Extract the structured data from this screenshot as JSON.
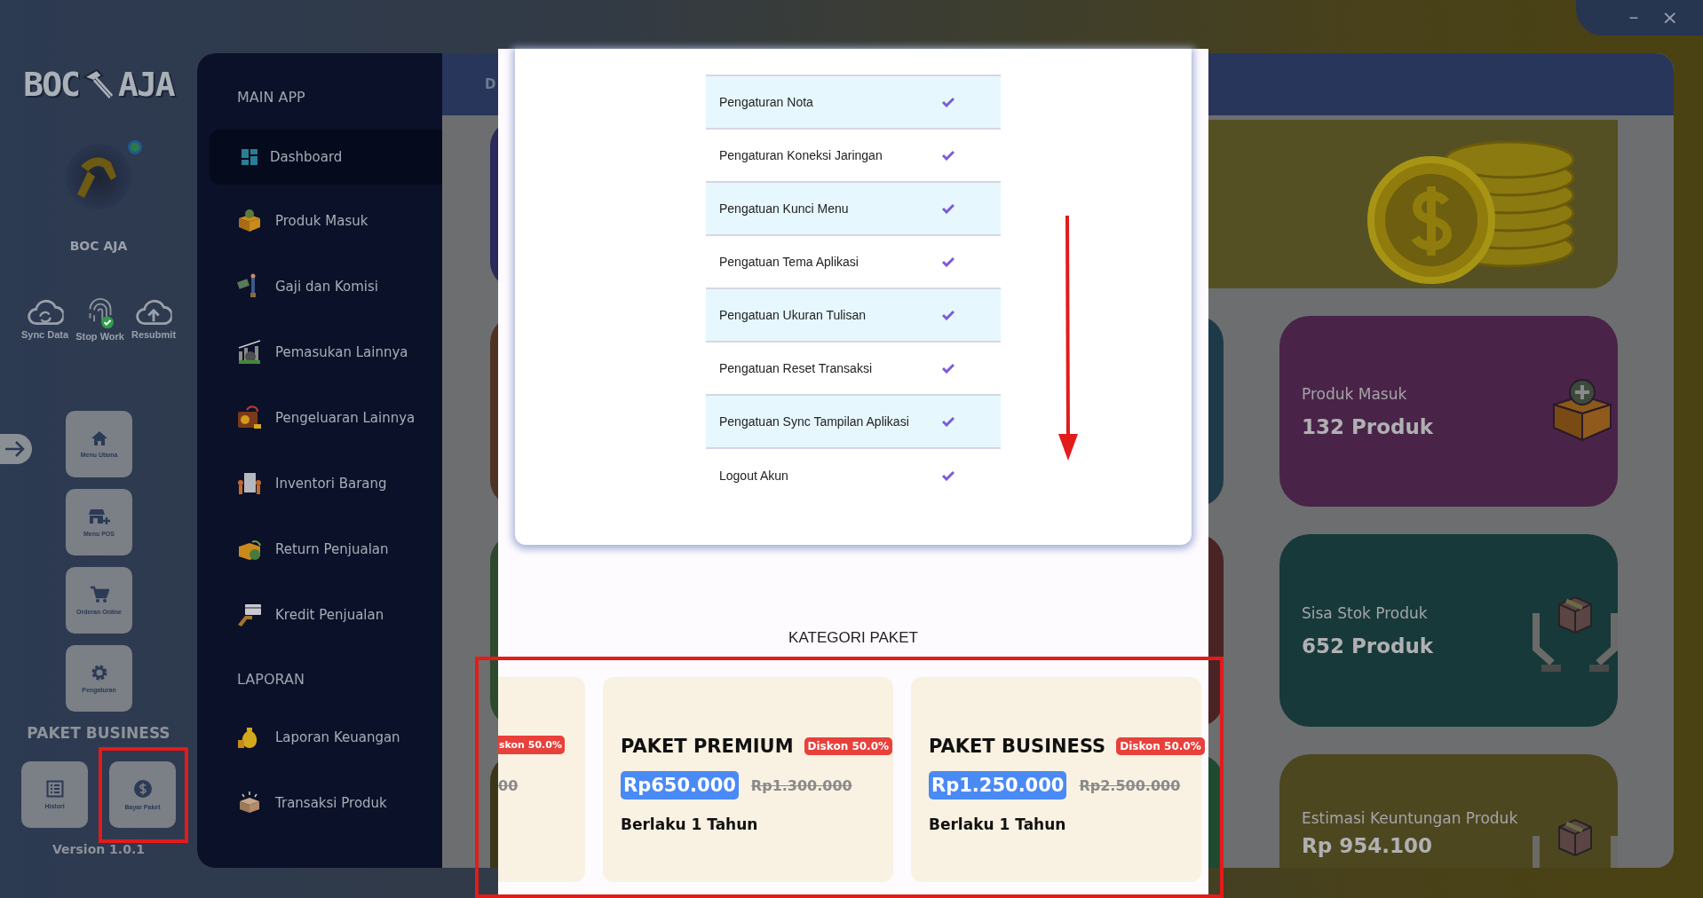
{
  "window_controls": [
    {
      "kind": "minimize",
      "label": "–"
    },
    {
      "kind": "close",
      "label": "×"
    }
  ],
  "rail": {
    "logo": {
      "left": "BOC",
      "right": "AJA"
    },
    "profile": {
      "name": "BOC AJA"
    },
    "actions": [
      {
        "kind": "sync",
        "label": "Sync Data"
      },
      {
        "kind": "fingerprint",
        "label": "Stop Work"
      },
      {
        "kind": "upload",
        "label": "Resubmit"
      }
    ],
    "menu_buttons": [
      {
        "kind": "home",
        "label": "Menu Utama"
      },
      {
        "kind": "store",
        "label": "Menu POS"
      },
      {
        "kind": "cart",
        "label": "Orderan Online"
      },
      {
        "kind": "gear",
        "label": "Pengaturan"
      }
    ],
    "package_title": "PAKET BUSINESS",
    "package_buttons": [
      {
        "kind": "list",
        "label": "Histori"
      },
      {
        "kind": "dollar",
        "label": "Bayar Paket"
      }
    ],
    "version": "Version 1.0.1"
  },
  "nav": {
    "sections": [
      {
        "title": "MAIN APP",
        "items": [
          {
            "kind": "dashboard",
            "label": "Dashboard",
            "selected": true
          },
          {
            "kind": "box",
            "label": "Produk Masuk",
            "selected": false
          },
          {
            "kind": "salary",
            "label": "Gaji dan Komisi",
            "selected": false
          },
          {
            "kind": "income",
            "label": "Pemasukan Lainnya",
            "selected": false
          },
          {
            "kind": "wallet",
            "label": "Pengeluaran Lainnya",
            "selected": false
          },
          {
            "kind": "inventory",
            "label": "Inventori Barang",
            "selected": false
          },
          {
            "kind": "return",
            "label": "Return Penjualan",
            "selected": false
          },
          {
            "kind": "card",
            "label": "Kredit Penjualan",
            "selected": false
          }
        ]
      },
      {
        "title": "LAPORAN",
        "items": [
          {
            "kind": "moneybag",
            "label": "Laporan Keuangan",
            "selected": false
          },
          {
            "kind": "parcel",
            "label": "Transaksi Produk",
            "selected": false
          }
        ]
      }
    ]
  },
  "header": {
    "title": "D"
  },
  "stat_cards": [
    {
      "kind": "box-plus",
      "label": "Produk Masuk",
      "value": "132 Produk",
      "color": "#4a2448"
    },
    {
      "kind": "hands-box",
      "label": "Sisa Stok Produk",
      "value": "652 Produk",
      "color": "#17393a"
    },
    {
      "kind": "hands-box",
      "label": "Estimasi Keuntungan Produk",
      "value": "Rp 954.100",
      "color": "#4d4720"
    }
  ],
  "modal": {
    "settings": [
      "Pengaturan Nota",
      "Pengaturan Koneksi Jaringan",
      "Pengatuan Kunci Menu",
      "Pengatuan Tema Aplikasi",
      "Pengatuan Ukuran Tulisan",
      "Pengatuan Reset Transaksi",
      "Pengatuan Sync Tampilan Aplikasi",
      "Logout Akun"
    ],
    "package_heading": "KATEGORI PAKET",
    "packages": [
      {
        "badge": "skon 50.0%",
        "old_price": "00"
      },
      {
        "name": "PAKET PREMIUM",
        "badge": "Diskon 50.0%",
        "price": "Rp650.000",
        "old_price": "Rp1.300.000",
        "validity": "Berlaku 1 Tahun"
      },
      {
        "name": "PAKET BUSINESS",
        "badge": "Diskon 50.0%",
        "price": "Rp1.250.000",
        "old_price": "Rp2.500.000",
        "validity": "Berlaku 1 Tahun"
      }
    ]
  }
}
